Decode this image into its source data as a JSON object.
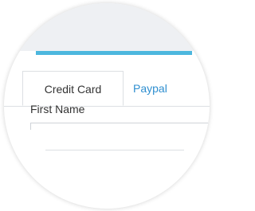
{
  "tabs": [
    {
      "label": "Credit Card",
      "active": true
    },
    {
      "label": "Paypal",
      "active": false
    }
  ],
  "form": {
    "first_name_label": "First Name",
    "first_name_value": ""
  },
  "colors": {
    "accent_bar": "#4db7de",
    "paypal_tab_text": "#2f8fd0",
    "header_background": "#eef0f3"
  }
}
